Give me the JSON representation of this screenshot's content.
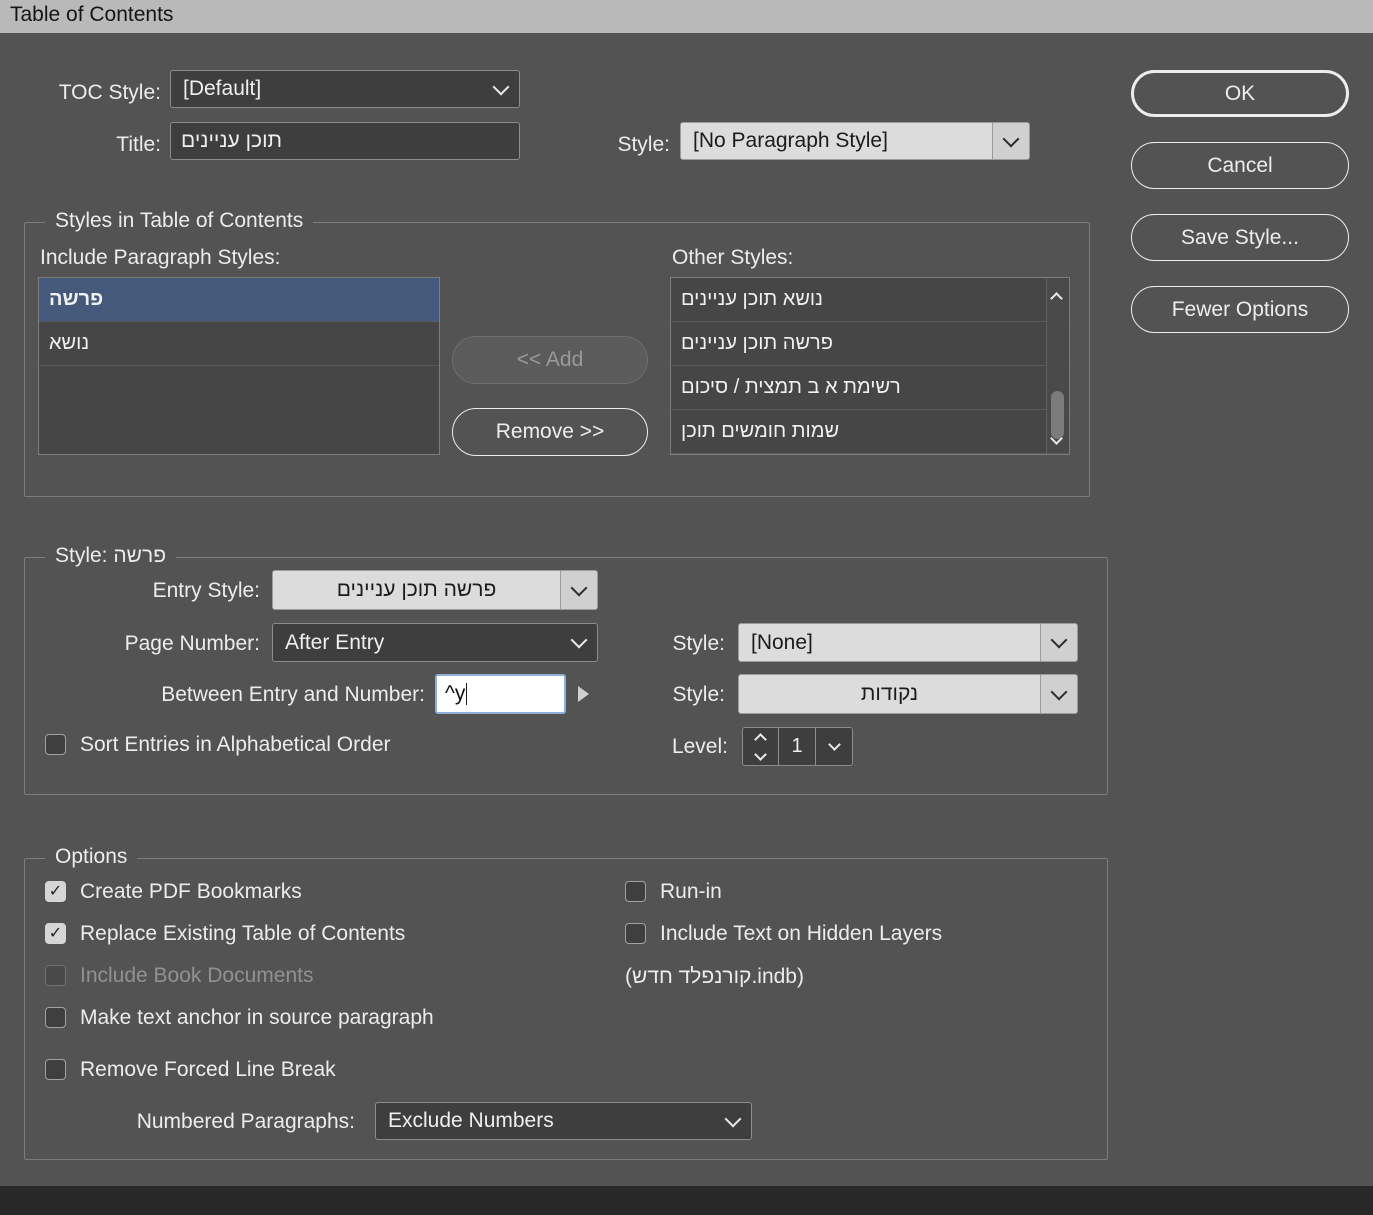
{
  "titlebar": {
    "title": "Table of Contents"
  },
  "colors": {
    "dialog_bg": "#535353",
    "selection": "#45597b",
    "titlebar_bg": "#b9b9b9"
  },
  "header": {
    "toc_style_label": "TOC Style:",
    "toc_style_value": "[Default]",
    "title_label": "Title:",
    "title_value": "תוכן עניינים",
    "style_label": "Style:",
    "style_value": "[No Paragraph Style]"
  },
  "actions": {
    "ok": "OK",
    "cancel": "Cancel",
    "save_style": "Save Style...",
    "fewer_options": "Fewer Options"
  },
  "styles_group": {
    "title": "Styles in Table of Contents",
    "include_label": "Include Paragraph Styles:",
    "include_items": [
      {
        "label": "פרשה",
        "selected": true
      },
      {
        "label": "נושא",
        "selected": false
      }
    ],
    "add_button": "<< Add",
    "remove_button": "Remove >>",
    "other_label": "Other Styles:",
    "other_items": [
      {
        "label": "נושא תוכן עניינים"
      },
      {
        "label": "פרשה תוכן עניינים"
      },
      {
        "label": "רשימת א ב תמצית / סיכום"
      },
      {
        "label": "שמות חומשים תוכן"
      }
    ]
  },
  "style_group": {
    "title_label": "Style:",
    "title_value": "פרשה",
    "entry_style_label": "Entry Style:",
    "entry_style_value": "פרשה תוכן עניינים",
    "page_number_label": "Page Number:",
    "page_number_value": "After Entry",
    "page_style_label": "Style:",
    "page_style_value": "[None]",
    "between_label": "Between Entry and Number:",
    "between_value": "^y",
    "between_style_label": "Style:",
    "between_style_value": "נקודות",
    "sort_label": "Sort Entries in Alphabetical Order",
    "level_label": "Level:",
    "level_value": "1"
  },
  "options_group": {
    "title": "Options",
    "left_checks": [
      {
        "label": "Create PDF Bookmarks",
        "checked": true,
        "disabled": false
      },
      {
        "label": "Replace Existing Table of Contents",
        "checked": true,
        "disabled": false
      },
      {
        "label": "Include Book Documents",
        "checked": false,
        "disabled": true
      },
      {
        "label": "Make text anchor in source paragraph",
        "checked": false,
        "disabled": false
      },
      {
        "label": "Remove Forced Line Break",
        "checked": false,
        "disabled": false
      }
    ],
    "right_checks": [
      {
        "label": "Run-in",
        "checked": false,
        "disabled": false
      },
      {
        "label": "Include Text on Hidden Layers",
        "checked": false,
        "disabled": false
      }
    ],
    "book_file": "(קורנפלד חדש.indb)",
    "numbered_label": "Numbered Paragraphs:",
    "numbered_value": "Exclude Numbers"
  }
}
